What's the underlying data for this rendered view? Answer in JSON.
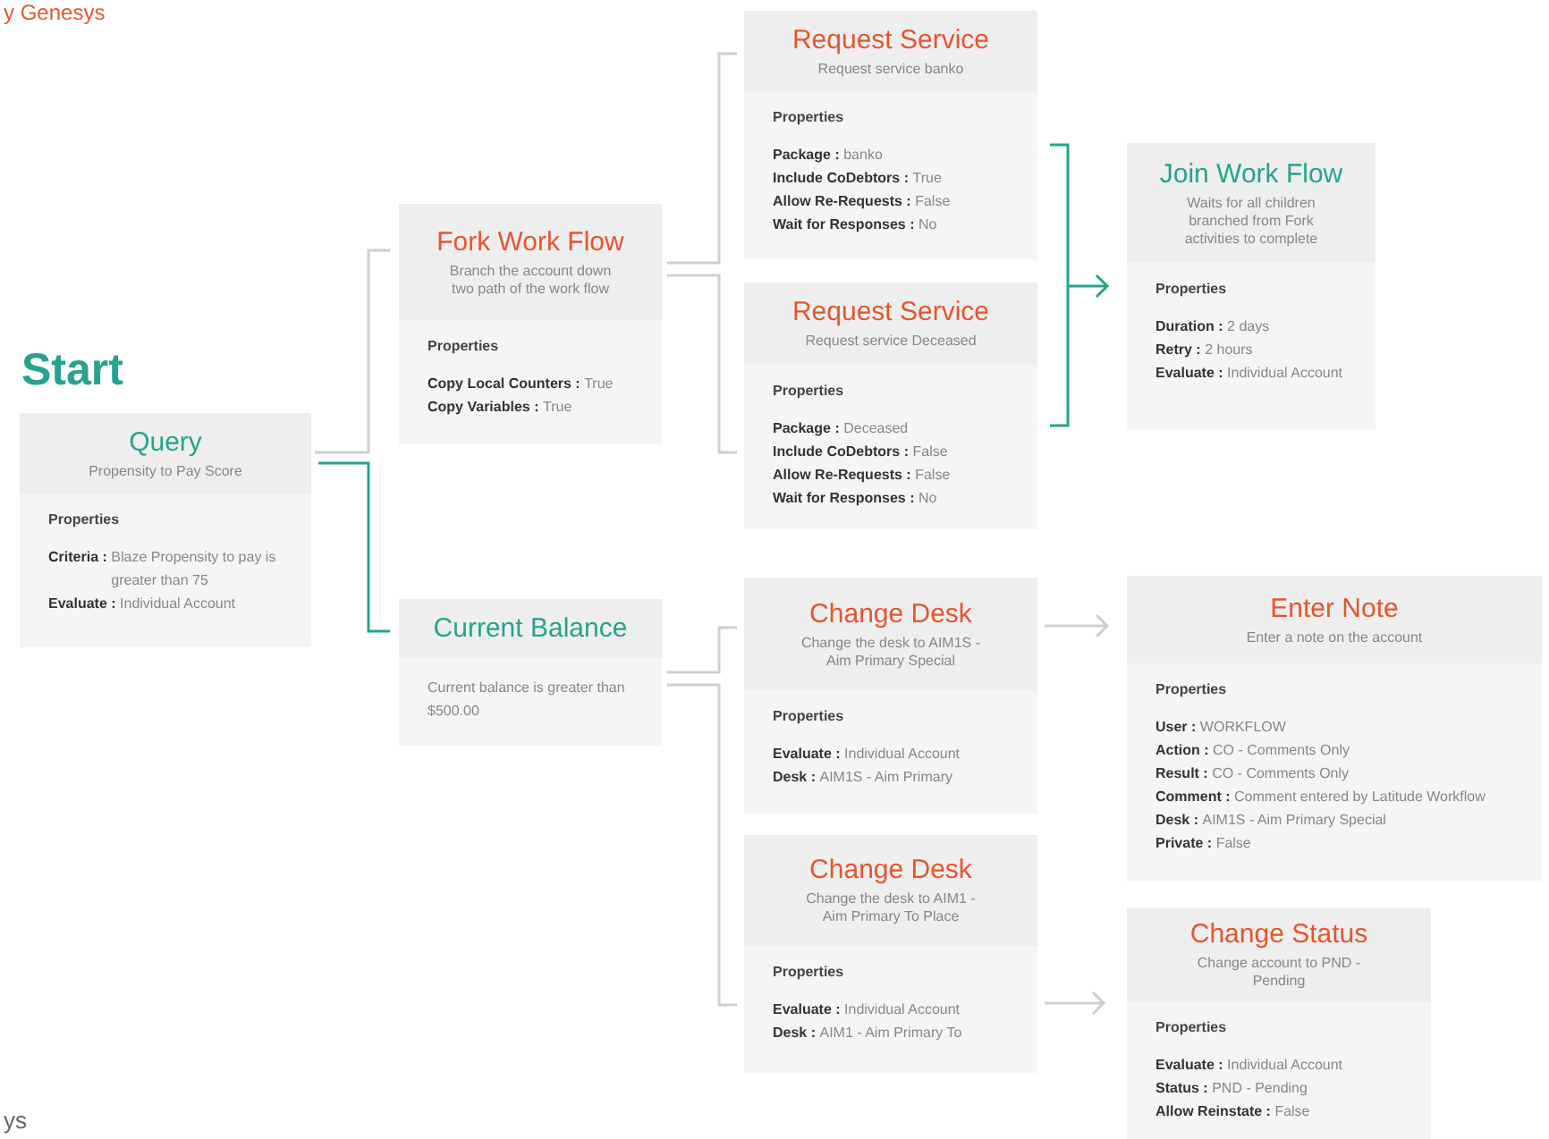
{
  "brand_top": "y Genesys",
  "start_label": "Start",
  "nodes": [
    {
      "title": "Query",
      "color": "#26a38e",
      "description": "Propensity to Pay Score",
      "properties_heading": "Properties",
      "properties": [
        {
          "key": "Criteria :",
          "value": "Blaze Propensity to pay is greater than 75"
        },
        {
          "key": "Evaluate :",
          "value": "Individual Account"
        }
      ]
    },
    {
      "title": "Fork Work Flow",
      "color": "#e8552d",
      "description": "Branch the account down two path of the work flow",
      "properties_heading": "Properties",
      "properties": [
        {
          "key": "Copy Local Counters :",
          "value": "True"
        },
        {
          "key": "Copy Variables :",
          "value": "True"
        }
      ]
    },
    {
      "title": "Current Balance",
      "color": "#26a38e",
      "body": "Current balance is greater than $500.00"
    },
    {
      "title": "Request Service",
      "color": "#e8552d",
      "description": "Request service banko",
      "properties_heading": "Properties",
      "properties": [
        {
          "key": "Package :",
          "value": "banko"
        },
        {
          "key": "Include CoDebtors :",
          "value": "True"
        },
        {
          "key": "Allow Re-Requests :",
          "value": "False"
        },
        {
          "key": "Wait for Responses :",
          "value": "No"
        }
      ]
    },
    {
      "title": "Request Service",
      "color": "#e8552d",
      "description": "Request service Deceased",
      "properties_heading": "Properties",
      "properties": [
        {
          "key": "Package :",
          "value": "Deceased"
        },
        {
          "key": "Include CoDebtors :",
          "value": "False"
        },
        {
          "key": "Allow Re-Requests :",
          "value": "False"
        },
        {
          "key": "Wait for Responses :",
          "value": "No"
        }
      ]
    },
    {
      "title": "Join Work Flow",
      "color": "#26a38e",
      "description": "Waits for all children branched from Fork activities to complete",
      "properties_heading": "Properties",
      "properties": [
        {
          "key": "Duration :",
          "value": "2 days"
        },
        {
          "key": "Retry :",
          "value": "2 hours"
        },
        {
          "key": "Evaluate :",
          "value": "Individual Account"
        }
      ]
    },
    {
      "title": "Change Desk",
      "color": "#e8552d",
      "description": "Change the desk to AIM1S - Aim Primary Special",
      "properties_heading": "Properties",
      "properties": [
        {
          "key": "Evaluate :",
          "value": "Individual Account"
        },
        {
          "key": "Desk :",
          "value": "AIM1S - Aim Primary"
        }
      ]
    },
    {
      "title": "Change Desk",
      "color": "#e8552d",
      "description": "Change the desk to AIM1 - Aim Primary To Place",
      "properties_heading": "Properties",
      "properties": [
        {
          "key": "Evaluate :",
          "value": "Individual Account"
        },
        {
          "key": "Desk :",
          "value": "AIM1 - Aim Primary To"
        }
      ]
    },
    {
      "title": "Enter Note",
      "color": "#e8552d",
      "description": "Enter a note on the account",
      "properties_heading": "Properties",
      "properties": [
        {
          "key": "User :",
          "value": "WORKFLOW"
        },
        {
          "key": "Action :",
          "value": "CO - Comments Only"
        },
        {
          "key": "Result :",
          "value": "CO - Comments Only"
        },
        {
          "key": "Comment :",
          "value": "Comment entered by Latitude Workflow"
        },
        {
          "key": "Desk :",
          "value": "AIM1S - Aim Primary Special"
        },
        {
          "key": "Private :",
          "value": "False"
        }
      ]
    },
    {
      "title": "Change Status",
      "color": "#e8552d",
      "description": "Change account to PND - Pending",
      "properties_heading": "Properties",
      "properties": [
        {
          "key": "Evaluate :",
          "value": "Individual Account"
        },
        {
          "key": "Status :",
          "value": "PND - Pending"
        },
        {
          "key": "Allow Reinstate :",
          "value": "False"
        }
      ]
    }
  ],
  "brand_bottom": "ys"
}
